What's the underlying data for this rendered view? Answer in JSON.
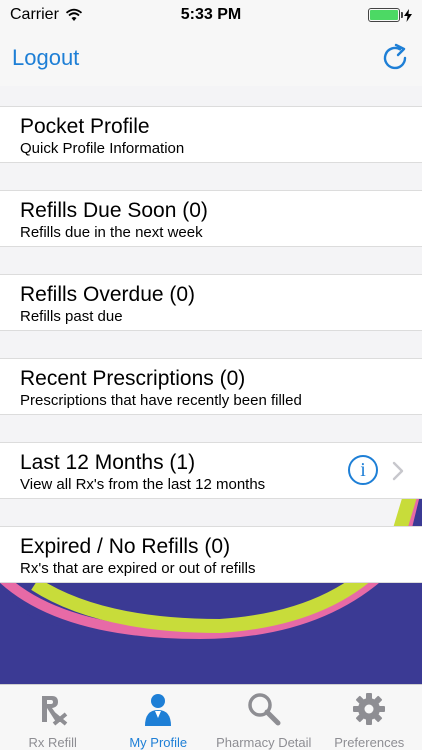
{
  "status_bar": {
    "carrier": "Carrier",
    "time": "5:33 PM"
  },
  "nav": {
    "logout_label": "Logout"
  },
  "rows": [
    {
      "title": "Pocket Profile",
      "subtitle": "Quick Profile Information"
    },
    {
      "title": "Refills Due Soon (0)",
      "subtitle": "Refills due in the next week"
    },
    {
      "title": "Refills Overdue (0)",
      "subtitle": "Refills past due"
    },
    {
      "title": "Recent Prescriptions (0)",
      "subtitle": "Prescriptions that have recently been filled"
    },
    {
      "title": "Last 12 Months (1)",
      "subtitle": "View all Rx's from the last 12 months",
      "info_glyph": "i"
    },
    {
      "title": "Expired / No Refills (0)",
      "subtitle": "Rx's that are expired or out of refills"
    }
  ],
  "tabs": [
    {
      "label": "Rx Refill",
      "icon": "rx-icon",
      "active": false
    },
    {
      "label": "My Profile",
      "icon": "person-icon",
      "active": true
    },
    {
      "label": "Pharmacy Detail",
      "icon": "magnifier-icon",
      "active": false
    },
    {
      "label": "Preferences",
      "icon": "gear-icon",
      "active": false
    }
  ],
  "colors": {
    "accent": "#1e7fd6",
    "background_navy": "#3b3a94",
    "arc_lime": "#c8dc3a",
    "arc_pink": "#e76aa6",
    "tab_inactive": "#8e8e93"
  }
}
